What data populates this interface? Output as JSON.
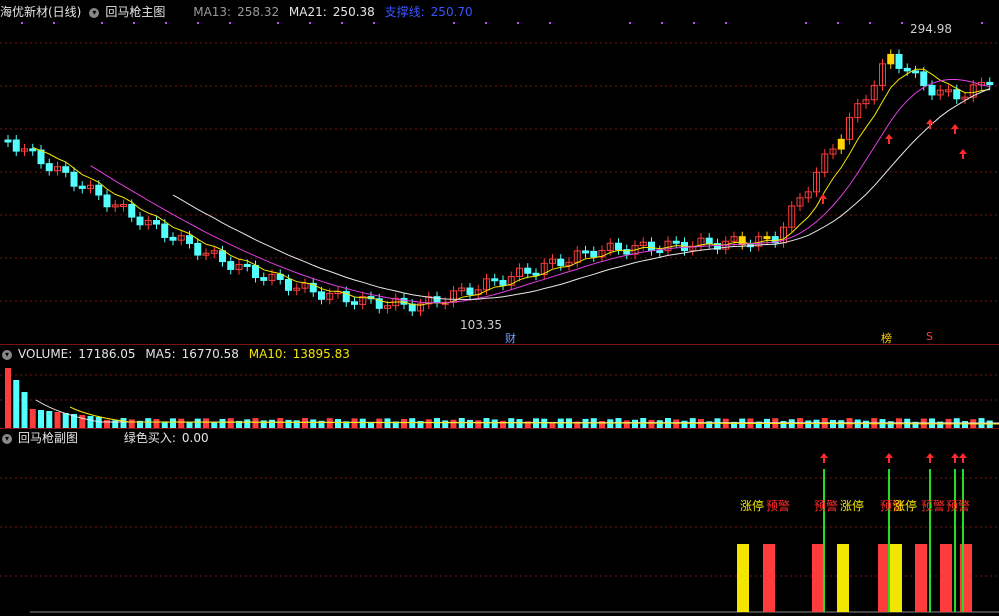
{
  "main_header": {
    "title": "海优新材(日线)",
    "indicator_name": "回马枪主图",
    "ma13_label": "MA13:",
    "ma13_value": "258.32",
    "ma21_label": "MA21:",
    "ma21_value": "250.38",
    "support_label": "支撑线:",
    "support_value": "250.70"
  },
  "main_chart": {
    "high_label": "294.98",
    "low_label": "103.35",
    "marker_cai": "财",
    "marker_bang": "榜",
    "marker_s": "S"
  },
  "volume_header": {
    "volume_label": "VOLUME:",
    "volume_value": "17186.05",
    "ma5_label": "MA5:",
    "ma5_value": "16770.58",
    "ma10_label": "MA10:",
    "ma10_value": "13895.83"
  },
  "sub_header": {
    "indicator_name": "回马枪副图",
    "green_buy_label": "绿色买入:",
    "green_buy_value": "0.00"
  },
  "sub_chart": {
    "signals": [
      {
        "text": "涨停",
        "color": "#f2e600"
      },
      {
        "text": "预警",
        "color": "#ff2a2a"
      },
      {
        "text": "预警",
        "color": "#ff2a2a"
      },
      {
        "text": "涨停",
        "color": "#f2e600"
      },
      {
        "text": "预警",
        "color": "#ff2a2a"
      },
      {
        "text": "涨停",
        "color": "#f2e600"
      },
      {
        "text": "预警",
        "color": "#ff2a2a"
      },
      {
        "text": "预警",
        "color": "#ff2a2a"
      }
    ]
  },
  "colors": {
    "up": "#ff3c3c",
    "down": "#54ffff",
    "limit_up": "#ffd400",
    "ma_white": "#e8e8e8",
    "ma_magenta": "#e040e0",
    "ma_yellow": "#f2e600",
    "grid": "#7a1414",
    "buy_arrow": "#ff2a2a",
    "green_line": "#22dd22"
  }
}
